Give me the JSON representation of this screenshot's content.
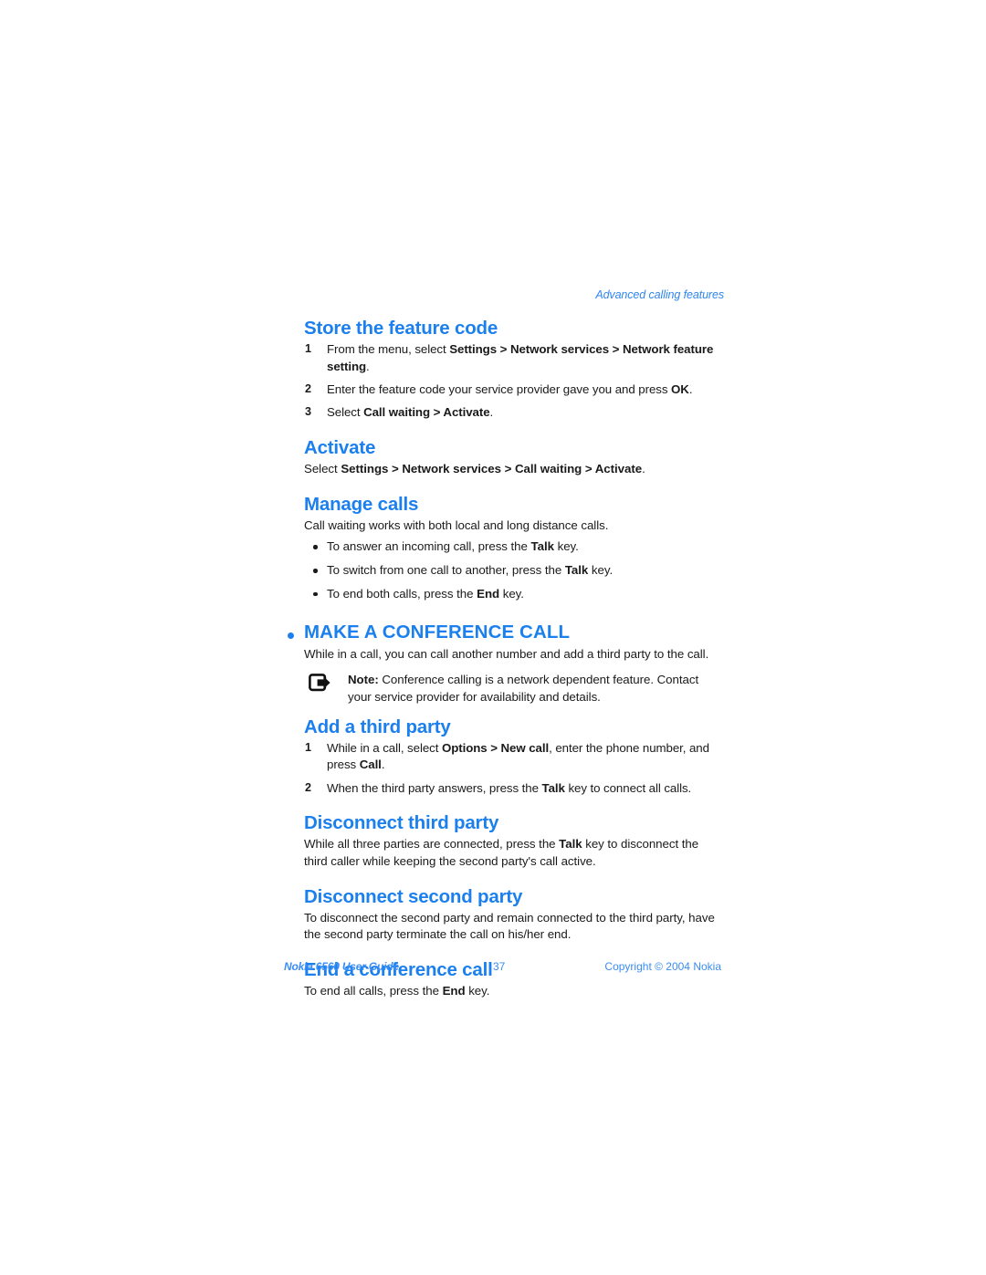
{
  "running_header": "Advanced calling features",
  "sections": [
    {
      "id": "store-the-feature-code",
      "heading": "Store the feature code",
      "steps": [
        {
          "num": "1",
          "parts": [
            {
              "t": "From the menu, select ",
              "b": false
            },
            {
              "t": "Settings > Network services > Network feature setting",
              "b": true
            },
            {
              "t": ".",
              "b": false
            }
          ]
        },
        {
          "num": "2",
          "parts": [
            {
              "t": "Enter the feature code your service provider gave you and press ",
              "b": false
            },
            {
              "t": "OK",
              "b": true
            },
            {
              "t": ".",
              "b": false
            }
          ]
        },
        {
          "num": "3",
          "parts": [
            {
              "t": "Select ",
              "b": false
            },
            {
              "t": "Call waiting > Activate",
              "b": true
            },
            {
              "t": ".",
              "b": false
            }
          ]
        }
      ]
    },
    {
      "id": "activate",
      "heading": "Activate",
      "paragraph": [
        {
          "t": "Select ",
          "b": false
        },
        {
          "t": "Settings > Network services > Call waiting > Activate",
          "b": true
        },
        {
          "t": ".",
          "b": false
        }
      ]
    },
    {
      "id": "manage-calls",
      "heading": "Manage calls",
      "paragraph": [
        {
          "t": "Call waiting works with both local and long distance calls.",
          "b": false
        }
      ],
      "bullets": [
        [
          {
            "t": "To answer an incoming call, press the ",
            "b": false
          },
          {
            "t": "Talk",
            "b": true
          },
          {
            "t": " key.",
            "b": false
          }
        ],
        [
          {
            "t": "To switch from one call to another, press the ",
            "b": false
          },
          {
            "t": "Talk",
            "b": true
          },
          {
            "t": " key.",
            "b": false
          }
        ],
        [
          {
            "t": "To end both calls, press the ",
            "b": false
          },
          {
            "t": "End",
            "b": true
          },
          {
            "t": " key.",
            "b": false
          }
        ]
      ]
    }
  ],
  "chapter": {
    "id": "make-a-conference-call",
    "heading": "MAKE A CONFERENCE CALL",
    "intro": [
      {
        "t": "While in a call, you can call another number and add a third party to the call.",
        "b": false
      }
    ],
    "note": {
      "icon": "note-arrow-icon",
      "parts": [
        {
          "t": "Note:",
          "b": true
        },
        {
          "t": " Conference calling is a network dependent feature. Contact your service provider for availability and details.",
          "b": false
        }
      ]
    },
    "sections": [
      {
        "id": "add-a-third-party",
        "heading": "Add a third party",
        "steps": [
          {
            "num": "1",
            "parts": [
              {
                "t": "While in a call, select ",
                "b": false
              },
              {
                "t": "Options > New call",
                "b": true
              },
              {
                "t": ", enter the phone number, and press ",
                "b": false
              },
              {
                "t": "Call",
                "b": true
              },
              {
                "t": ".",
                "b": false
              }
            ]
          },
          {
            "num": "2",
            "parts": [
              {
                "t": "When the third party answers, press the ",
                "b": false
              },
              {
                "t": "Talk",
                "b": true
              },
              {
                "t": " key to connect all calls.",
                "b": false
              }
            ]
          }
        ]
      },
      {
        "id": "disconnect-third-party",
        "heading": "Disconnect third party",
        "paragraph": [
          {
            "t": "While all three parties are connected, press the ",
            "b": false
          },
          {
            "t": "Talk",
            "b": true
          },
          {
            "t": " key to disconnect the third caller while keeping the second party's call active.",
            "b": false
          }
        ]
      },
      {
        "id": "disconnect-second-party",
        "heading": "Disconnect second party",
        "paragraph": [
          {
            "t": "To disconnect the second party and remain connected to the third party, have the second party terminate the call on his/her end.",
            "b": false
          }
        ]
      },
      {
        "id": "end-a-conference-call",
        "heading": "End a conference call",
        "paragraph": [
          {
            "t": "To end all calls, press the ",
            "b": false
          },
          {
            "t": "End",
            "b": true
          },
          {
            "t": " key.",
            "b": false
          }
        ]
      }
    ]
  },
  "footer": {
    "left": "Nokia 6560 User Guide",
    "page_number": "37",
    "right": "Copyright © 2004 Nokia"
  },
  "colors": {
    "heading_blue": "#1b80ee",
    "header_blue": "#2f85f0",
    "footer_blue": "#3a8df2",
    "body_text": "#1a1a1a",
    "background": "#ffffff"
  }
}
